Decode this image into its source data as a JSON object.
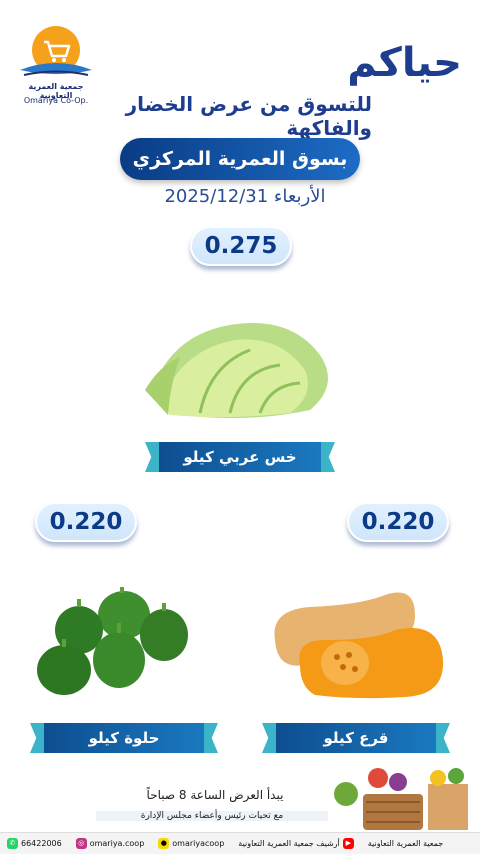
{
  "logo": {
    "name_ar": "جمعية العمرية التعاونية",
    "name_en": "Omariya Co-Op."
  },
  "header": {
    "greeting": "حياكم",
    "subtitle": "للتسوق من عرض الخضار والفاكهة",
    "market": "بسوق العمرية المركزي",
    "date": "الأربعاء 2025/12/31"
  },
  "products": [
    {
      "price": "0.275",
      "label": "خس عربي كيلو"
    },
    {
      "price": "0.220",
      "label": "حلوة كيلو"
    },
    {
      "price": "0.220",
      "label": "قرع كيلو"
    }
  ],
  "footer": {
    "start_time": "يبدأ العرض الساعة 8 صباحاً",
    "regards": "مع تحيات رئيس وأعضاء مجلس الإدارة"
  },
  "bottombar": {
    "phone": "66422006",
    "instagram": "omariya.coop",
    "snapchat": "omariyacoop",
    "youtube": "أرشيف جمعية العمرية التعاونية",
    "name": "جمعية العمرية التعاونية"
  },
  "colors": {
    "brand_blue": "#1f3d8f",
    "accent_teal": "#3bb3c8",
    "logo_orange": "#f5a11c"
  }
}
